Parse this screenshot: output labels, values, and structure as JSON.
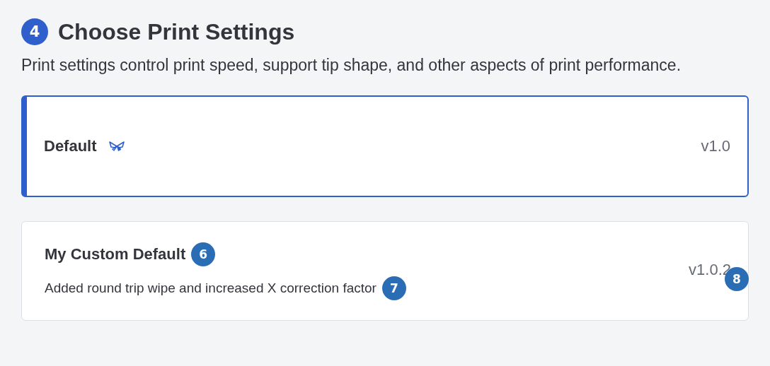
{
  "header": {
    "step": "4",
    "title": "Choose Print Settings",
    "description": "Print settings control print speed, support tip shape, and other aspects of print performance."
  },
  "options": [
    {
      "name": "Default",
      "featured": true,
      "version": "v1.0",
      "selected": true
    },
    {
      "name": "My Custom Default",
      "name_marker": "6",
      "featured": false,
      "version": "v1.0.2",
      "version_marker": "8",
      "description": "Added round trip wipe and increased X correction factor",
      "description_marker": "7",
      "selected": false
    }
  ]
}
